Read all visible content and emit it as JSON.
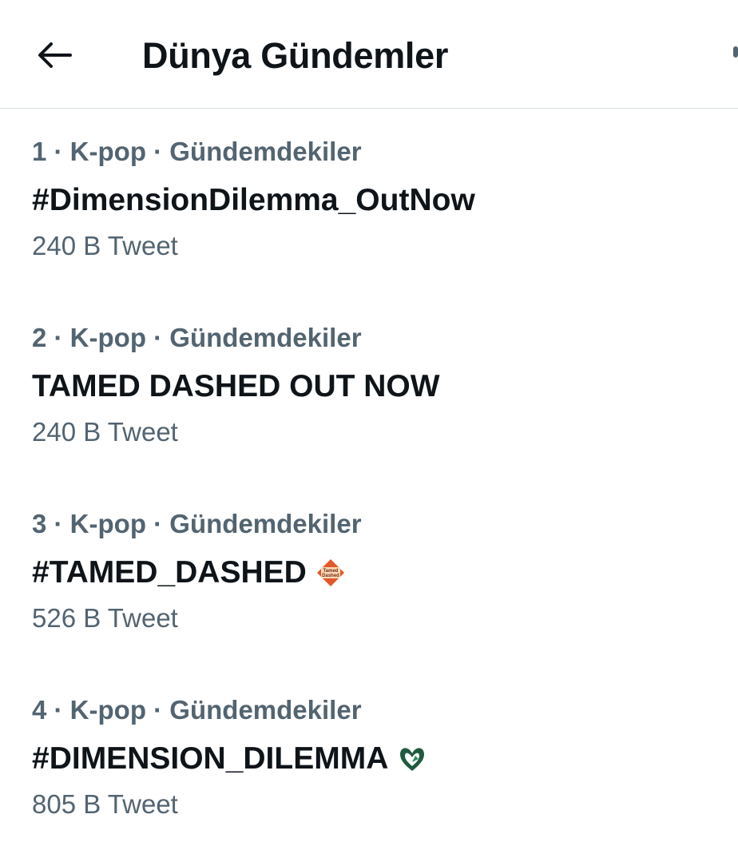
{
  "header": {
    "title": "Dünya Gündemler",
    "back_icon": "arrow-left-icon"
  },
  "colors": {
    "primary_text": "#0f1419",
    "secondary_text": "#536471",
    "divider": "#d8e0e6"
  },
  "trends": [
    {
      "meta": "1 · K-pop · Gündemdekiler",
      "title": "#DimensionDilemma_OutNow",
      "count": "240 B Tweet",
      "hashflag": ""
    },
    {
      "meta": "2 · K-pop · Gündemdekiler",
      "title": "TAMED DASHED OUT NOW",
      "count": "240 B Tweet",
      "hashflag": ""
    },
    {
      "meta": "3 · K-pop · Gündemdekiler",
      "title": "#TAMED_DASHED",
      "count": "526 B Tweet",
      "hashflag": "tamed-dashed-hashflag-icon",
      "hashflag_text": "Tamed Dashed"
    },
    {
      "meta": "4 · K-pop · Gündemdekiler",
      "title": "#DIMENSION_DILEMMA",
      "count": "805 B Tweet",
      "hashflag": "dimension-dilemma-hashflag-icon"
    }
  ]
}
